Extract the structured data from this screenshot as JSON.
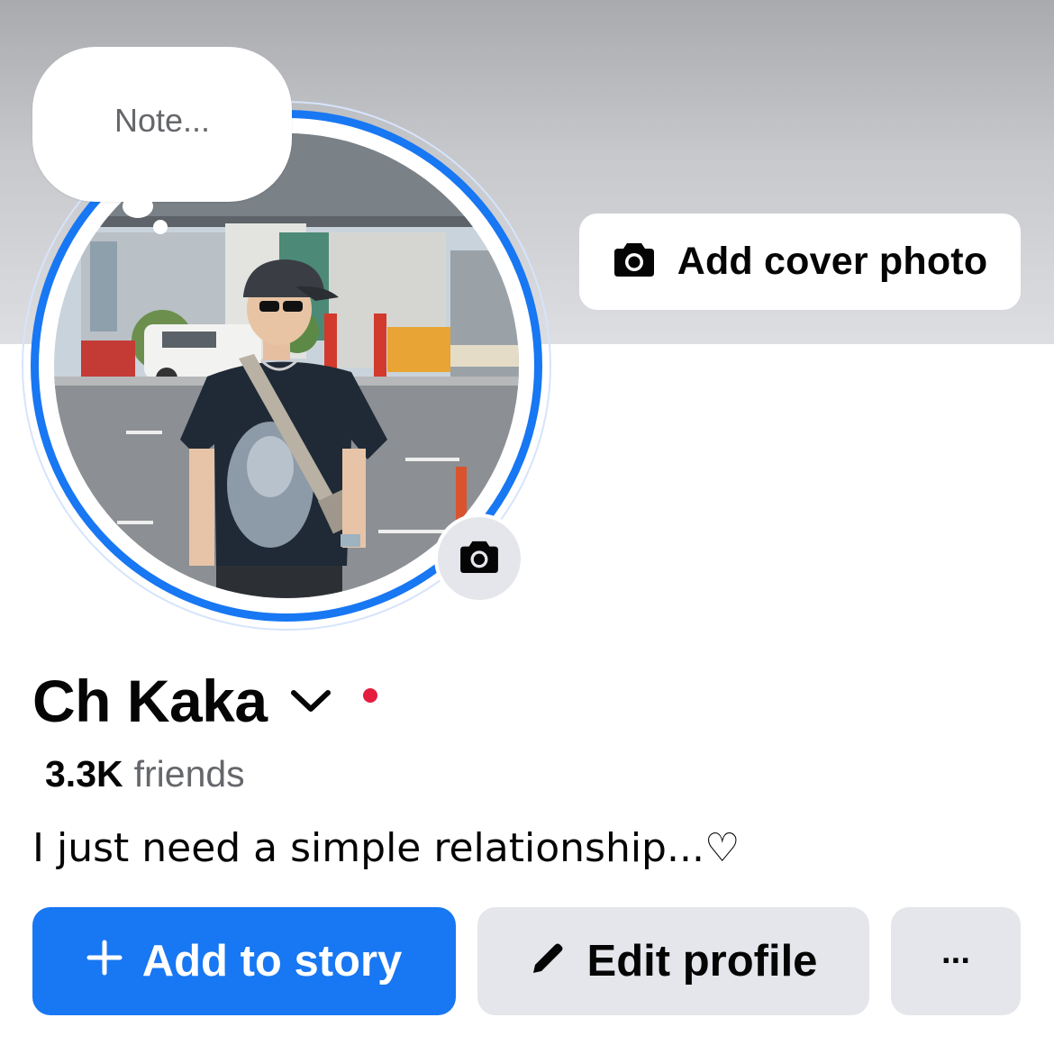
{
  "note": {
    "placeholder": "Note..."
  },
  "cover": {
    "button_label": "Add cover photo",
    "button_icon": "camera-icon"
  },
  "profile": {
    "name": "Ch Kaka",
    "friends_count": "3.3K",
    "friends_word": "friends",
    "bio": "I just need a simple relationship...♡",
    "status_dot_color": "#e41e3f",
    "avatar_ring_color": "#1877f2"
  },
  "actions": {
    "add_story": "Add to story",
    "add_story_icon": "plus-icon",
    "edit_profile": "Edit profile",
    "edit_profile_icon": "pencil-icon",
    "more": "···"
  },
  "colors": {
    "accent": "#1877f2",
    "secondary_button": "#e4e6eb",
    "muted_text": "#65676b"
  }
}
